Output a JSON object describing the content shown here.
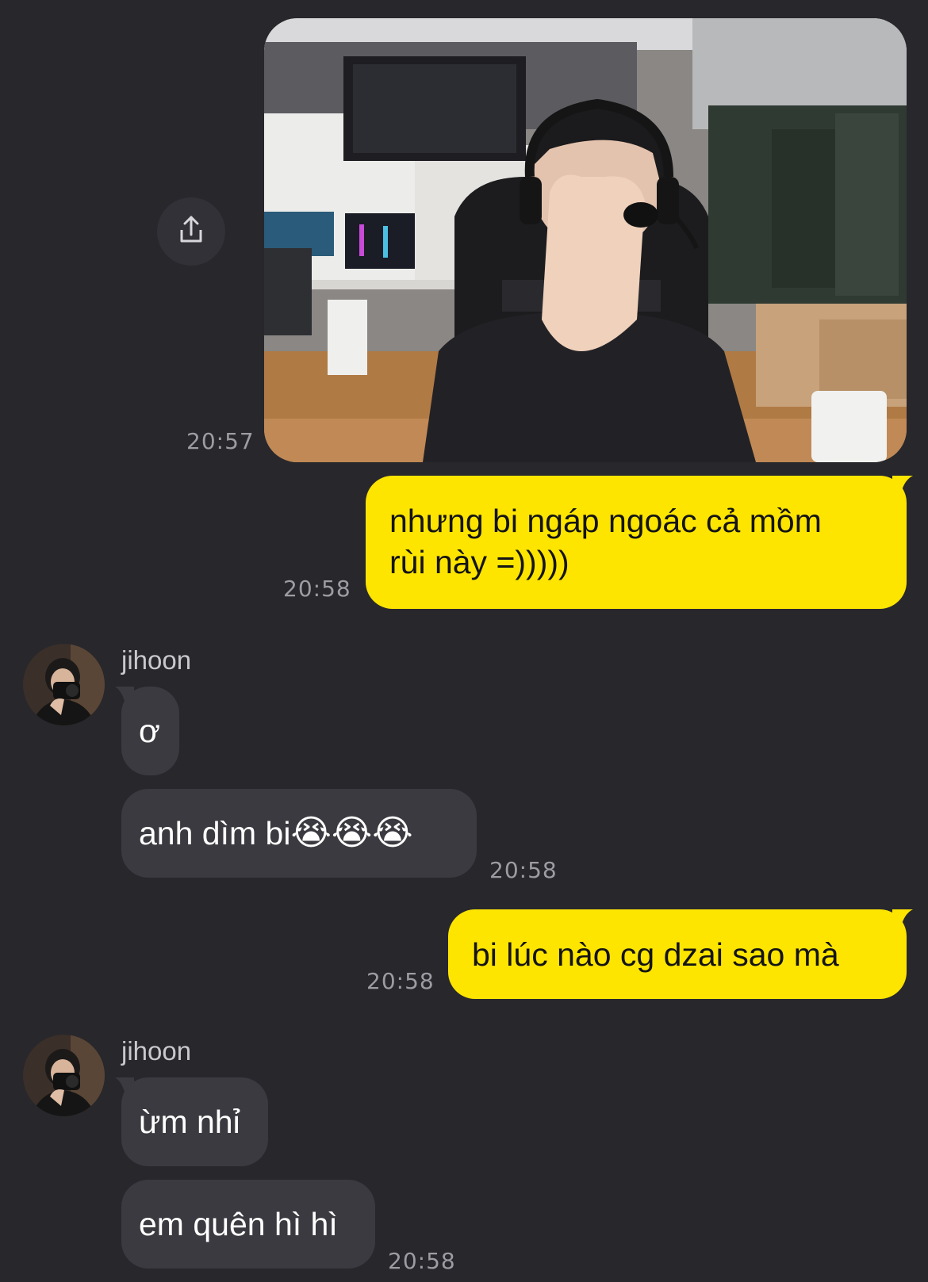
{
  "messages": {
    "photo": {
      "time": "20:57",
      "share_icon": "share-icon"
    },
    "sent_1": {
      "line1": "nhưng bi ngáp ngoác cả mồm",
      "line2": "rùi này =)))))",
      "time": "20:58"
    },
    "recv_group_1": {
      "sender": "jihoon",
      "msg1": "ơ",
      "msg2_text": "anh dìm bi",
      "msg2_emojis": "😭😭😭",
      "time": "20:58"
    },
    "sent_2": {
      "text": "bi lúc nào cg dzai sao mà",
      "time": "20:58"
    },
    "recv_group_2": {
      "sender": "jihoon",
      "msg1": "ừm nhỉ",
      "msg2": "em quên hì hì",
      "time": "20:58"
    }
  },
  "colors": {
    "background": "#28272c",
    "sent_bubble": "#fee500",
    "received_bubble": "#3b3a40",
    "timestamp": "#9e9ca3"
  }
}
